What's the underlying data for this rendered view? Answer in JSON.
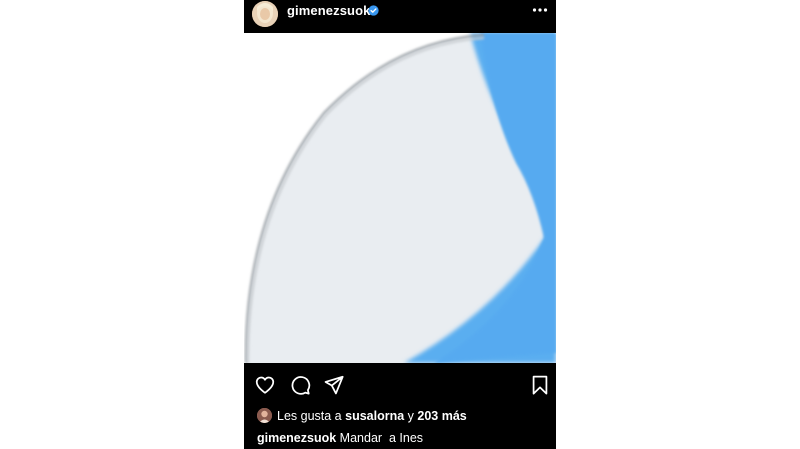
{
  "post": {
    "username": "gimenezsuok",
    "verified": true,
    "avatar_icon": "profile-avatar",
    "more_icon": "more-options-icon",
    "photo_colors": {
      "background": "#eceff2",
      "shape_fill": "#e9edf1",
      "shape_edge": "#9aa0a6",
      "stripe": "#5aaef0"
    },
    "actions": {
      "like_icon": "heart-icon",
      "comment_icon": "comment-icon",
      "share_icon": "share-icon",
      "save_icon": "bookmark-icon"
    },
    "likes": {
      "prefix": "Les gusta a",
      "liker": "susalorna",
      "connector": "y",
      "others": "203 más"
    },
    "caption": {
      "author": "gimenezsuok",
      "text": "Mandar  a Ines"
    }
  },
  "colors": {
    "post_bg": "#000000",
    "text": "#ffffff",
    "verified": "#3897f0",
    "page_bg": "#ffffff"
  }
}
